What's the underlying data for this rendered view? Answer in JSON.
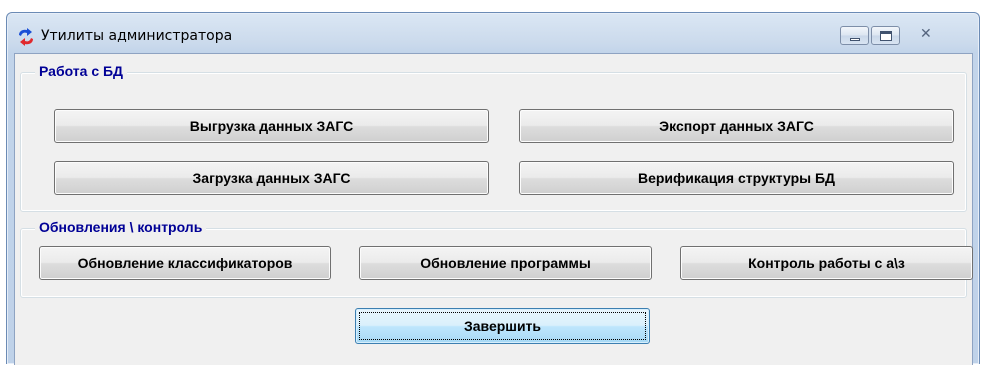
{
  "window": {
    "title": "Утилиты администратора",
    "icon": "refresh-arrows-icon",
    "accent_colors": {
      "arrow_top": "#1a4fd6",
      "arrow_bottom": "#e0282d"
    }
  },
  "caption_buttons": {
    "minimize": "minimize-icon",
    "maximize": "maximize-icon",
    "close": "close-icon",
    "close_glyph": "✕"
  },
  "groups": {
    "db": {
      "title": "Работа с БД",
      "buttons": {
        "unload": "Выгрузка данных ЗАГС",
        "export": "Экспорт данных ЗАГС",
        "load": "Загрузка данных ЗАГС",
        "verify": "Верификация структуры БД"
      }
    },
    "updates": {
      "title": "Обновления \\ контроль",
      "buttons": {
        "update_classifiers": "Обновление классификаторов",
        "update_program": "Обновление программы",
        "control": "Контроль работы с а\\з"
      }
    }
  },
  "footer": {
    "finish_label": "Завершить"
  },
  "colors": {
    "group_title": "#000096",
    "client_bg": "#f0f0f0"
  }
}
